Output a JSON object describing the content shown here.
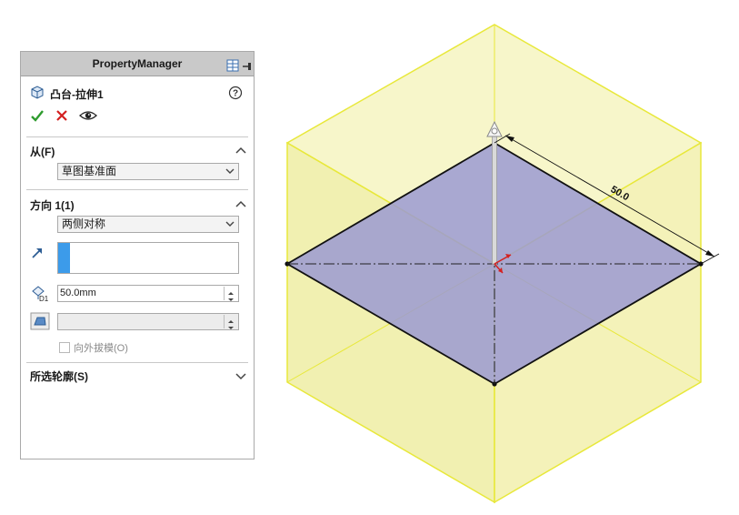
{
  "panel": {
    "title": "PropertyManager",
    "feature_title": "凸台-拉伸1",
    "from_section": {
      "label": "从(F)",
      "selected": "草图基准面"
    },
    "direction_section": {
      "label": "方向 1(1)",
      "end_condition": "两侧对称",
      "depth_value": "50.0mm",
      "draft_checkbox_label": "向外拔模(O)",
      "draft_checked": false
    },
    "contours_section": {
      "label": "所选轮廓(S)"
    }
  },
  "viewport": {
    "dimension_label": "50.0",
    "colors": {
      "solid_fill": "#f4f3b4",
      "solid_edge": "#e8e83a",
      "sketch_fill": "#9b9ad2",
      "dimension_line": "#111111"
    }
  },
  "colors": {
    "header_bg": "#c9c9c9",
    "ok_green": "#2e9b2e",
    "cancel_red": "#d42020",
    "selection_blue": "#3c9bea"
  }
}
